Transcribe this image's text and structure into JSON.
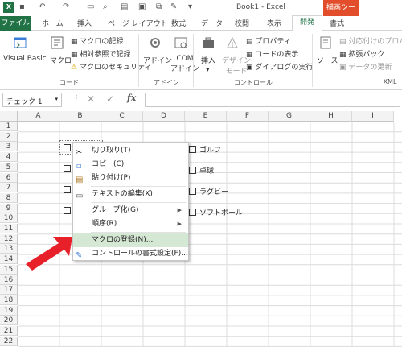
{
  "app": {
    "title": "Book1 - Excel",
    "context_tab": "描画ツール"
  },
  "tabs": [
    {
      "label": "ファイル"
    },
    {
      "label": "ホーム"
    },
    {
      "label": "挿入"
    },
    {
      "label": "ページ レイアウト"
    },
    {
      "label": "数式"
    },
    {
      "label": "データ"
    },
    {
      "label": "校閲"
    },
    {
      "label": "表示"
    },
    {
      "label": "開発"
    },
    {
      "label": "書式"
    }
  ],
  "ribbon": {
    "code": {
      "visual_basic": "Visual Basic",
      "macro": "マクロ",
      "record_macro": "マクロの記録",
      "relative_ref": "相対参照で記録",
      "macro_security": "マクロのセキュリティ",
      "group_label": "コード"
    },
    "addins": {
      "addins": "アドイン",
      "com_addins": "COM\nアドイン",
      "group_label": "アドイン"
    },
    "controls": {
      "insert": "挿入",
      "design_mode": "デザイン\nモード",
      "properties": "プロパティ",
      "view_code": "コードの表示",
      "run_dialog": "ダイアログの実行",
      "group_label": "コントロール"
    },
    "xml": {
      "source": "ソース",
      "map_properties": "対応付けのプロパ",
      "expansion_packs": "拡張パック",
      "refresh_data": "データの更新",
      "group_label": "XML"
    }
  },
  "formula_bar": {
    "name_box": "チェック 1",
    "fx": "fx"
  },
  "columns": [
    "A",
    "B",
    "C",
    "D",
    "E",
    "F",
    "G",
    "H",
    "I"
  ],
  "rows": [
    "1",
    "2",
    "3",
    "4",
    "5",
    "6",
    "7",
    "8",
    "9",
    "10",
    "11",
    "12",
    "13",
    "14",
    "15",
    "16",
    "17",
    "18",
    "19",
    "20",
    "21",
    "22"
  ],
  "checkboxes": [
    {
      "label": ""
    },
    {
      "label": ""
    },
    {
      "label": ""
    },
    {
      "label": ""
    },
    {
      "label": "ゴルフ"
    },
    {
      "label": "卓球"
    },
    {
      "label": "ラグビー"
    },
    {
      "label": "ソフトボール"
    }
  ],
  "context_menu": {
    "cut": "切り取り(T)",
    "copy": "コピー(C)",
    "paste": "貼り付け(P)",
    "edit_text": "テキストの編集(X)",
    "grouping": "グループ化(G)",
    "order": "順序(R)",
    "assign_macro": "マクロの登録(N)...",
    "format_control": "コントロールの書式設定(F)..."
  },
  "colors": {
    "accent": "#217346",
    "context_tab": "#e24e2b",
    "highlight": "#d5e8d4",
    "arrow": "#e8202a"
  }
}
